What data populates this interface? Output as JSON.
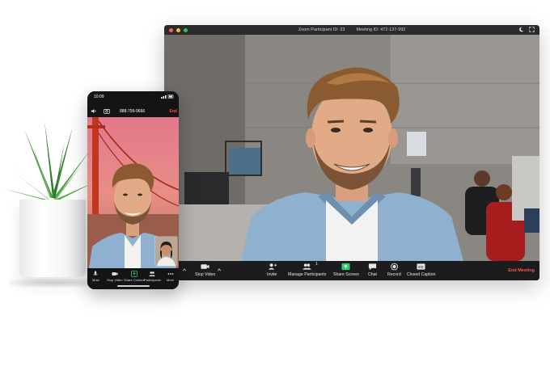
{
  "desktop": {
    "title_participant": "Zoom Participant ID: 23",
    "title_meeting": "Meeting ID: 472-137-992",
    "toolbar": {
      "stop_video": "Stop Video",
      "invite": "Invite",
      "manage_participants": "Manage Participants",
      "participant_count": "1",
      "share_screen": "Share Screen",
      "chat": "Chat",
      "record": "Record",
      "closed_caption": "Closed Caption",
      "end_meeting": "End Meeting"
    },
    "colors": {
      "end": "#f2584b",
      "share": "#2ecc71"
    }
  },
  "phone": {
    "time": "10:09",
    "number": "888-799-9666",
    "end": "End",
    "toolbar": {
      "mute": "Mute",
      "stop_video": "Stop Video",
      "share_content": "Share Content",
      "participants": "Participants",
      "more": "More"
    }
  }
}
